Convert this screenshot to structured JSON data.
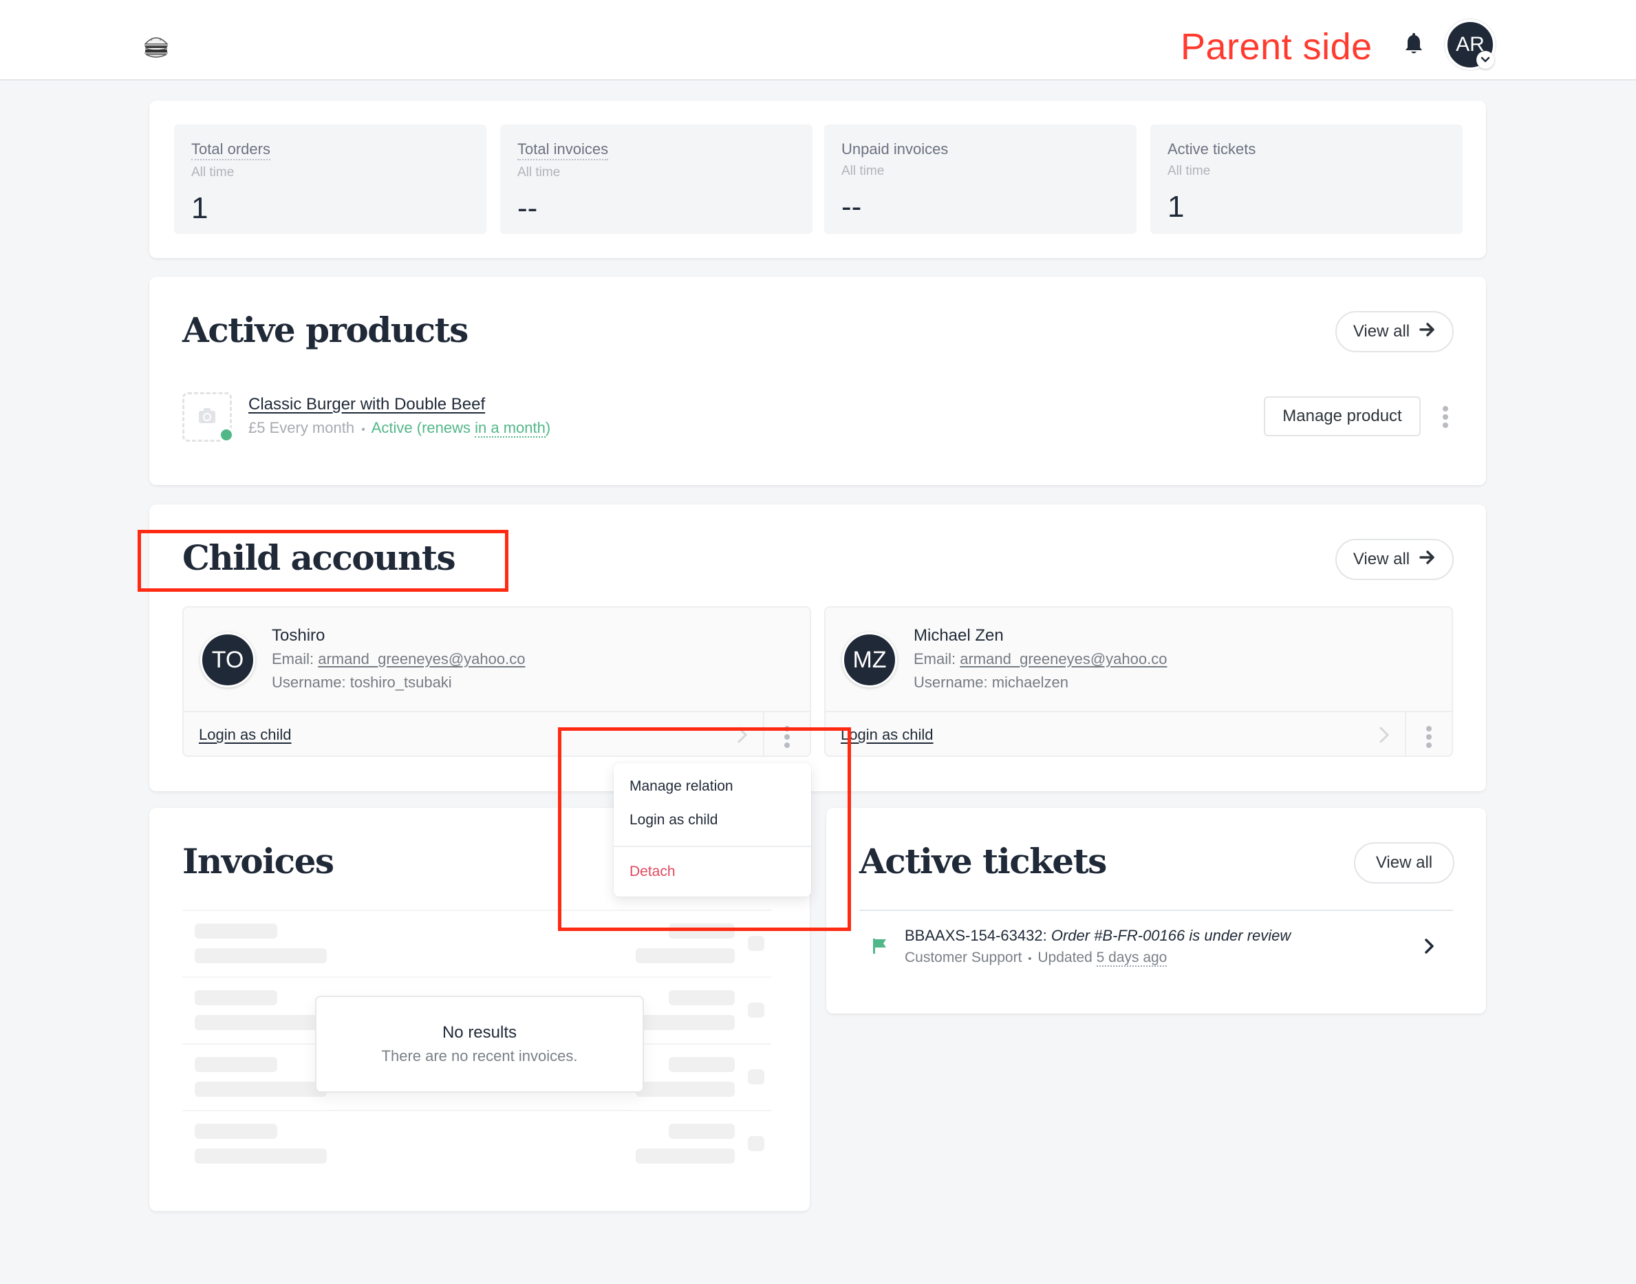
{
  "header": {
    "logo_alt": "burger-logo",
    "annotation": "Parent side",
    "notifications_icon": "bell-icon",
    "user_initials": "AR",
    "user_menu_icon": "chevron-down-icon"
  },
  "stats": [
    {
      "label": "Total orders",
      "period": "All time",
      "value": "1"
    },
    {
      "label": "Total invoices",
      "period": "All time",
      "value": "--"
    },
    {
      "label": "Unpaid invoices",
      "period": "All time",
      "value": "--"
    },
    {
      "label": "Active tickets",
      "period": "All time",
      "value": "1"
    }
  ],
  "active_products": {
    "title": "Active products",
    "view_all": "View all",
    "items": [
      {
        "name": "Classic Burger with Double Beef",
        "price": "£5 Every month",
        "separator": "•",
        "status_prefix": "Active (renews ",
        "status_relative": "in a month",
        "status_suffix": ")",
        "manage_label": "Manage product"
      }
    ]
  },
  "child_accounts": {
    "title": "Child accounts",
    "view_all": "View all",
    "items": [
      {
        "initials": "TO",
        "name": "Toshiro",
        "email_label": "Email: ",
        "email": "armand_greeneyes@yahoo.co",
        "username_label": "Username: ",
        "username": "toshiro_tsubaki",
        "login_label": "Login as child"
      },
      {
        "initials": "MZ",
        "name": "Michael Zen",
        "email_label": "Email: ",
        "email": "armand_greeneyes@yahoo.co",
        "username_label": "Username: ",
        "username": "michaelzen",
        "login_label": "Login as child"
      }
    ],
    "menu": {
      "items": [
        "Manage relation",
        "Login as child"
      ],
      "danger_item": "Detach"
    }
  },
  "invoices": {
    "title": "Invoices",
    "empty_title": "No results",
    "empty_message": "There are no recent invoices."
  },
  "active_tickets": {
    "title": "Active tickets",
    "view_all": "View all",
    "items": [
      {
        "id": "BBAAXS-154-63432:",
        "subject": "Order #B-FR-00166 is under review",
        "department": "Customer Support",
        "separator": "•",
        "updated_label": "Updated ",
        "updated_relative": "5 days ago"
      }
    ]
  },
  "colors": {
    "accent_dark": "#1f2937",
    "success": "#52b788",
    "danger": "#e0485f",
    "annotation_red": "#ff2a12"
  }
}
